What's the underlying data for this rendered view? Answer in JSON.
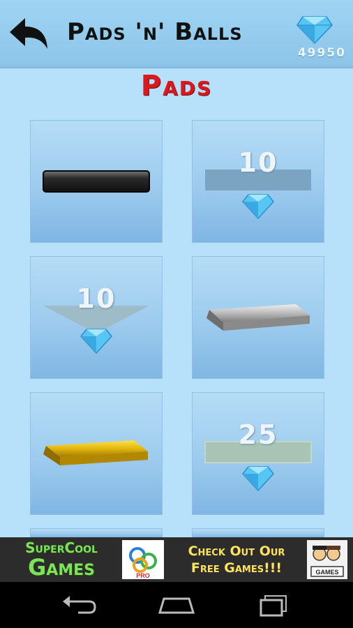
{
  "header": {
    "title": "Pads 'n' Balls",
    "gem_count": "49950"
  },
  "section": {
    "title": "Pads"
  },
  "pads": [
    {
      "cost": "",
      "locked": false,
      "style": "black"
    },
    {
      "cost": "10",
      "locked": true,
      "style": "flat"
    },
    {
      "cost": "10",
      "locked": true,
      "style": "triangle"
    },
    {
      "cost": "",
      "locked": false,
      "style": "silver"
    },
    {
      "cost": "",
      "locked": false,
      "style": "gold"
    },
    {
      "cost": "25",
      "locked": true,
      "style": "green"
    }
  ],
  "ad": {
    "brand_line1": "SuperCool",
    "brand_line2": "Games",
    "logo_badge": "PRO",
    "text_line1": "Check Out Our",
    "text_line2": "Free Games!!!",
    "icon_label": "GAMES"
  },
  "colors": {
    "accent": "#d9181f",
    "background": "#b7e1fa",
    "ad_green": "#7fe25a",
    "ad_yellow": "#ffe35c"
  }
}
